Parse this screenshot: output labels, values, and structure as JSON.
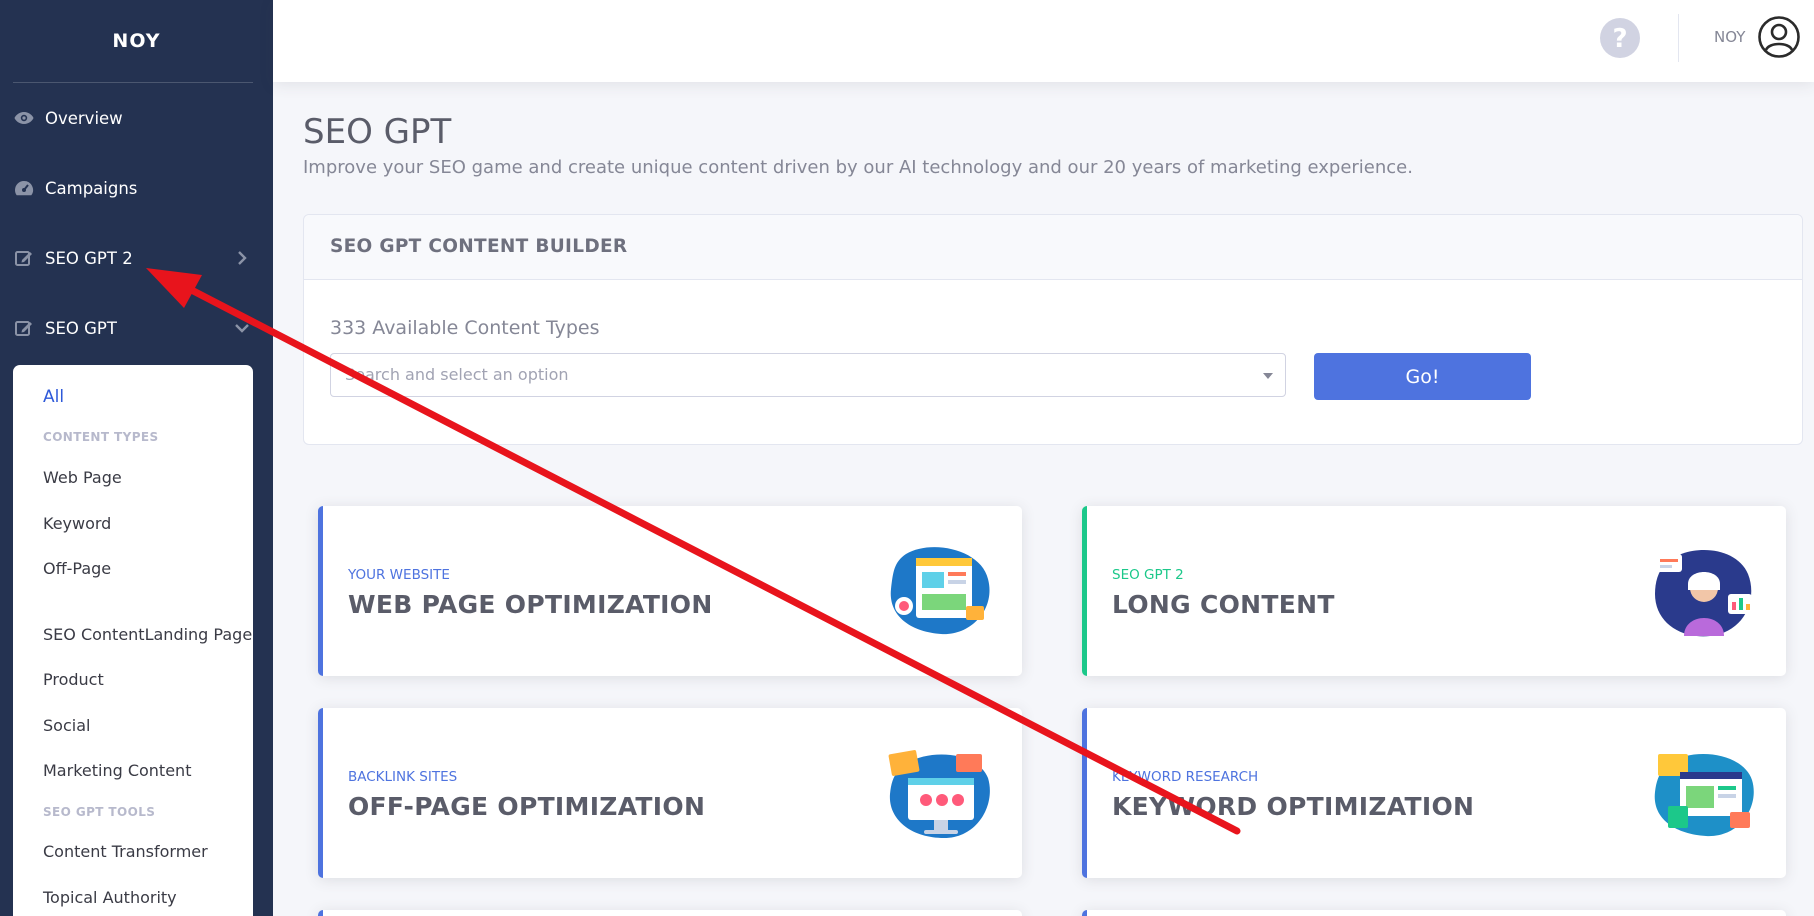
{
  "sidebar": {
    "brand": "NOY",
    "items": [
      {
        "label": "Overview",
        "icon": "eye-icon"
      },
      {
        "label": "Campaigns",
        "icon": "tachometer-icon"
      },
      {
        "label": "SEO GPT 2",
        "icon": "edit-icon",
        "chevron": "chevron-right-icon"
      },
      {
        "label": "SEO GPT",
        "icon": "edit-icon",
        "chevron": "chevron-down-icon"
      }
    ],
    "submenu": {
      "all": "All",
      "content_types_heading": "CONTENT TYPES",
      "web_page": "Web Page",
      "keyword": "Keyword",
      "off_page": "Off-Page",
      "seo_content_landing_page": "SEO ContentLanding Page",
      "product": "Product",
      "social": "Social",
      "marketing_content": "Marketing Content",
      "tools_heading": "SEO GPT TOOLS",
      "content_transformer": "Content Transformer",
      "topical_authority": "Topical Authority"
    }
  },
  "topbar": {
    "help_icon": "question-circle-icon",
    "user_name": "NOY",
    "avatar_icon": "user-circle-icon"
  },
  "page": {
    "title": "SEO GPT",
    "subtitle": "Improve your SEO game and create unique content driven by our AI technology and our 20 years of marketing experience."
  },
  "builder": {
    "header": "SEO GPT CONTENT BUILDER",
    "available": "333 Available Content Types",
    "select_placeholder": "Search and select an option",
    "go_label": "Go!"
  },
  "cards": [
    {
      "kicker": "YOUR WEBSITE",
      "title": "WEB PAGE OPTIMIZATION",
      "accent": "#4e73df"
    },
    {
      "kicker": "SEO GPT 2",
      "title": "LONG CONTENT",
      "accent": "#1cc88a"
    },
    {
      "kicker": "BACKLINK SITES",
      "title": "OFF-PAGE OPTIMIZATION",
      "accent": "#4e73df"
    },
    {
      "kicker": "KEYWORD RESEARCH",
      "title": "KEYWORD OPTIMIZATION",
      "accent": "#4e73df"
    }
  ],
  "colors": {
    "sidebar_bg": "#243251",
    "primary": "#4e73df",
    "success": "#1cc88a",
    "annotation": "#e8141c"
  }
}
